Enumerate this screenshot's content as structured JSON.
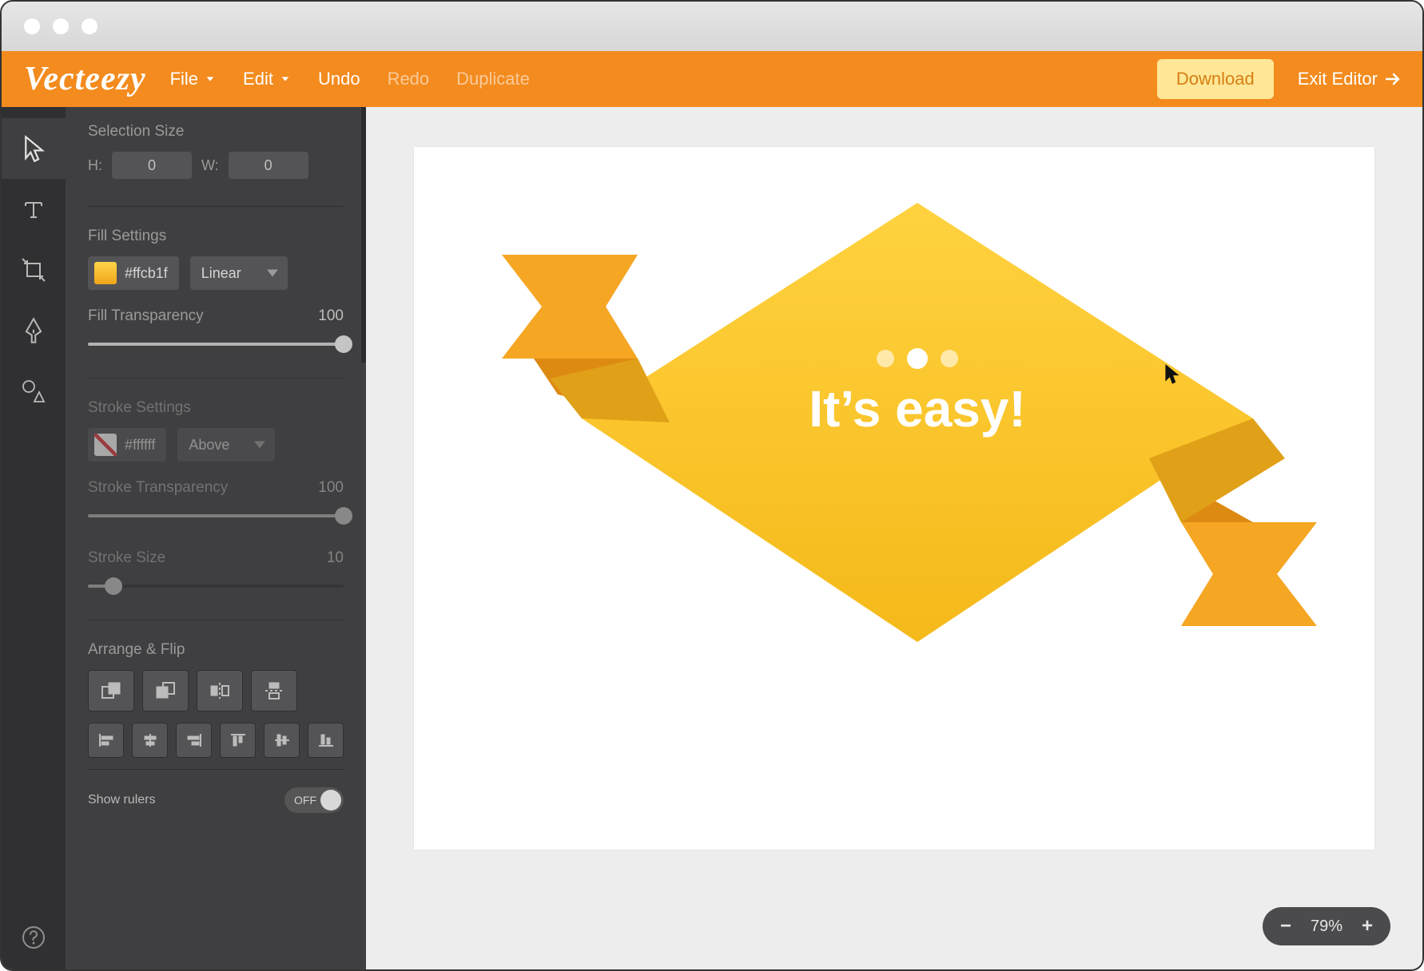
{
  "brand": "Vecteezy",
  "header": {
    "menu_file": "File",
    "menu_edit": "Edit",
    "undo": "Undo",
    "redo": "Redo",
    "duplicate": "Duplicate",
    "download": "Download",
    "exit": "Exit Editor"
  },
  "panel": {
    "selection_size_label": "Selection Size",
    "h_label": "H:",
    "w_label": "W:",
    "h_value": "0",
    "w_value": "0",
    "fill": {
      "section": "Fill Settings",
      "color_hex": "#ffcb1f",
      "mode": "Linear",
      "transparency_label": "Fill Transparency",
      "transparency_value": "100"
    },
    "stroke": {
      "section": "Stroke Settings",
      "color_hex": "#ffffff",
      "position": "Above",
      "transparency_label": "Stroke Transparency",
      "transparency_value": "100",
      "size_label": "Stroke Size",
      "size_value": "10"
    },
    "arrange_label": "Arrange & Flip",
    "rulers_label": "Show rulers",
    "rulers_state": "OFF"
  },
  "canvas": {
    "art_text": "It’s easy!"
  },
  "zoom": {
    "value": "79%"
  }
}
